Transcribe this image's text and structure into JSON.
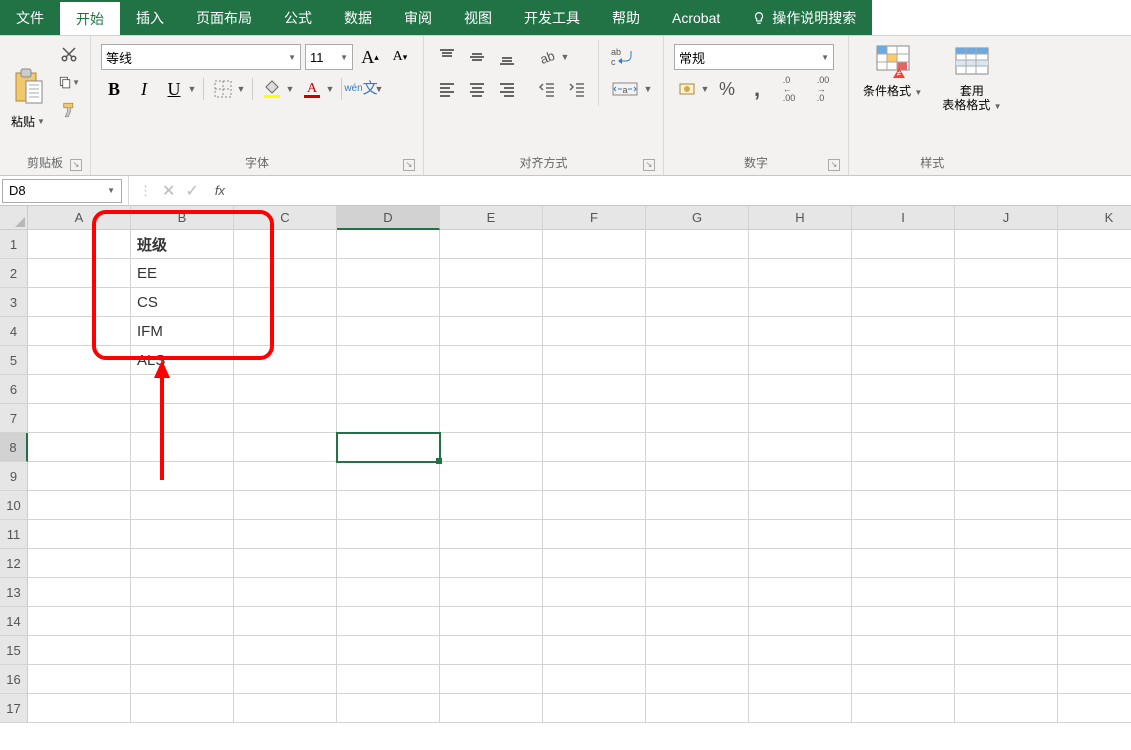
{
  "tabs": {
    "file": "文件",
    "home": "开始",
    "insert": "插入",
    "layout": "页面布局",
    "formulas": "公式",
    "data": "数据",
    "review": "审阅",
    "view": "视图",
    "dev": "开发工具",
    "help": "帮助",
    "acrobat": "Acrobat",
    "tellme": "操作说明搜索"
  },
  "ribbon": {
    "clipboard": {
      "paste": "粘贴",
      "label": "剪贴板"
    },
    "font": {
      "name": "等线",
      "size": "11",
      "label": "字体"
    },
    "phonetic": "wén",
    "alignment": {
      "label": "对齐方式"
    },
    "number": {
      "format": "常规",
      "p1": ".0",
      "p2": ".00",
      "p3": ".00",
      "p4": ".0",
      "label": "数字"
    },
    "styles": {
      "cond": "条件格式",
      "table": "套用\n表格格式",
      "label": "样式"
    }
  },
  "formula_bar": {
    "name_box": "D8",
    "fx": "fx"
  },
  "grid": {
    "columns": [
      "A",
      "B",
      "C",
      "D",
      "E",
      "F",
      "G",
      "H",
      "I",
      "J",
      "K"
    ],
    "rows": [
      "1",
      "2",
      "3",
      "4",
      "5",
      "6",
      "7",
      "8",
      "9",
      "10",
      "11",
      "12",
      "13",
      "14",
      "15",
      "16",
      "17"
    ],
    "active_col": "D",
    "active_row": "8",
    "data": {
      "B1": "班级",
      "B2": "EE",
      "B3": "CS",
      "B4": "IFM",
      "B5": "ALS"
    }
  }
}
